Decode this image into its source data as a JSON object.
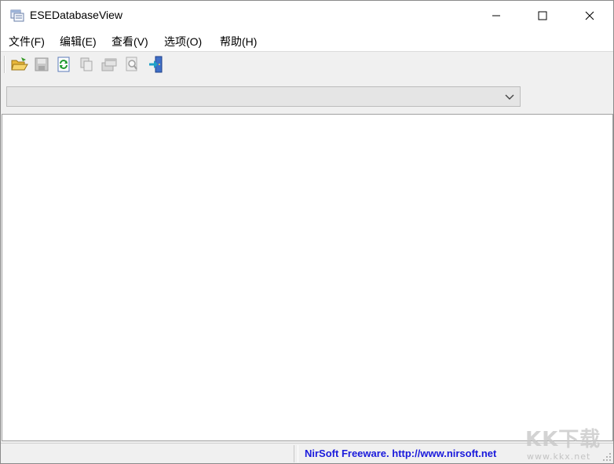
{
  "window": {
    "title": "ESEDatabaseView",
    "icon": "database-view-icon"
  },
  "window_controls": {
    "minimize": "minimize-icon",
    "maximize": "maximize-icon",
    "close": "close-icon"
  },
  "menu": {
    "items": [
      {
        "label": "文件(F)"
      },
      {
        "label": "编辑(E)"
      },
      {
        "label": "查看(V)"
      },
      {
        "label": "选项(O)"
      },
      {
        "label": "帮助(H)"
      }
    ]
  },
  "toolbar": {
    "buttons": [
      {
        "icon": "open-folder-icon",
        "enabled": true
      },
      {
        "icon": "save-icon",
        "enabled": false
      },
      {
        "icon": "refresh-icon",
        "enabled": true
      },
      {
        "icon": "copy-icon",
        "enabled": false
      },
      {
        "icon": "properties-icon",
        "enabled": false
      },
      {
        "icon": "find-icon",
        "enabled": false
      },
      {
        "icon": "exit-icon",
        "enabled": true
      }
    ]
  },
  "table_selector": {
    "selected_value": "",
    "icon": "chevron-down-icon"
  },
  "statusbar": {
    "left_text": "",
    "link_text": "NirSoft Freeware.  http://www.nirsoft.net"
  },
  "watermark": {
    "logo": "KK下载",
    "url": "www.kkx.net"
  },
  "colors": {
    "status_link": "#1a1adc",
    "window_bg": "#f0f0f0",
    "list_bg": "#ffffff"
  }
}
